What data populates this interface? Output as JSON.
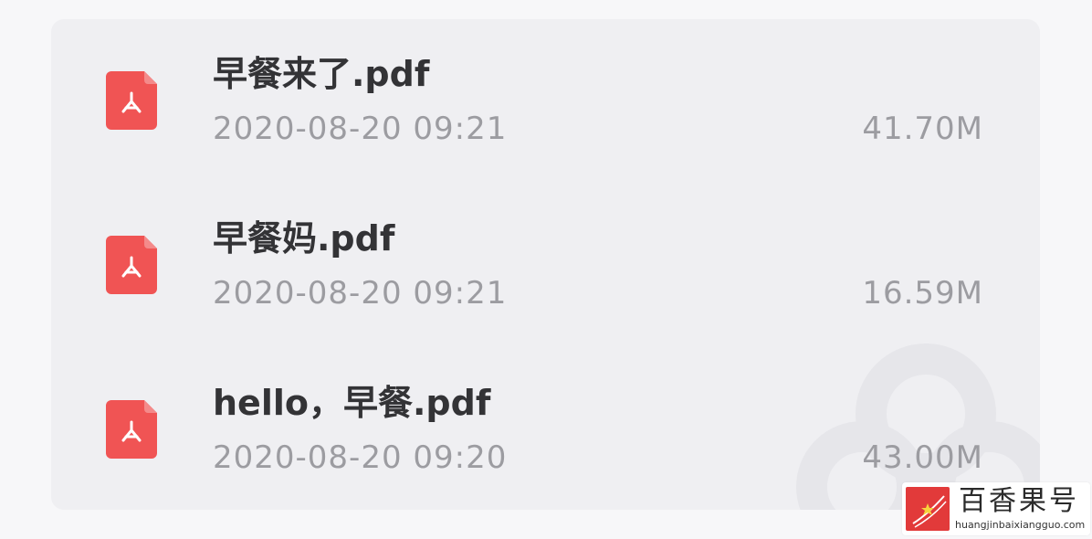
{
  "colors": {
    "pdf_red": "#f05454",
    "name_text": "#333336",
    "meta_text": "#9c9ca1",
    "card_bg": "#efeff2"
  },
  "files": [
    {
      "icon": "pdf-icon",
      "name": "早餐来了.pdf",
      "date": "2020-08-20 09:21",
      "size": "41.70M"
    },
    {
      "icon": "pdf-icon",
      "name": "早餐妈.pdf",
      "date": "2020-08-20 09:21",
      "size": "16.59M"
    },
    {
      "icon": "pdf-icon",
      "name": "hello，早餐.pdf",
      "date": "2020-08-20 09:20",
      "size": "43.00M"
    }
  ],
  "watermark": {
    "title": "百香果号",
    "url": "huangjinbaixiangguo.com"
  }
}
